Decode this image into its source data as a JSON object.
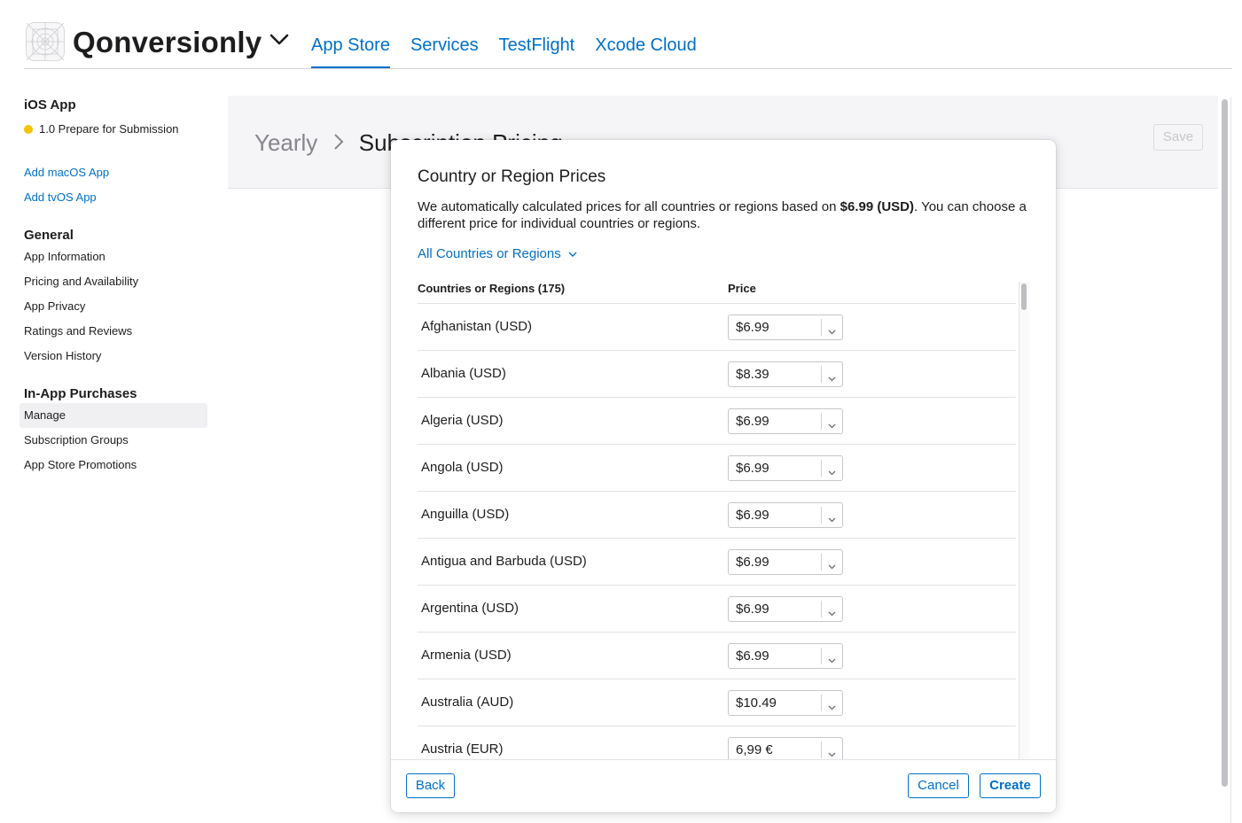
{
  "header": {
    "app_name": "Qonversionly",
    "tabs": [
      {
        "label": "App Store",
        "active": true
      },
      {
        "label": "Services"
      },
      {
        "label": "TestFlight"
      },
      {
        "label": "Xcode Cloud"
      }
    ]
  },
  "sidebar": {
    "ios_heading": "iOS App",
    "version_status": "1.0 Prepare for Submission",
    "status_color": "#f5c400",
    "add_links": [
      "Add macOS App",
      "Add tvOS App"
    ],
    "general_heading": "General",
    "general_items": [
      "App Information",
      "Pricing and Availability",
      "App Privacy",
      "Ratings and Reviews",
      "Version History"
    ],
    "iap_heading": "In-App Purchases",
    "iap_items": [
      "Manage",
      "Subscription Groups",
      "App Store Promotions"
    ],
    "selected_item": "Manage"
  },
  "page": {
    "breadcrumb_parent": "Yearly",
    "breadcrumb_current": "Subscription Pricing",
    "save_label": "Save"
  },
  "modal": {
    "title": "Country or Region Prices",
    "desc_before": "We automatically calculated prices for all countries or regions based on ",
    "desc_price": "$6.99 (USD)",
    "desc_after": ". You can choose a different price for individual countries or regions.",
    "filter_label": "All Countries or Regions",
    "col_country": "Countries or Regions (175)",
    "col_price": "Price",
    "rows": [
      {
        "country": "Afghanistan (USD)",
        "price": "$6.99"
      },
      {
        "country": "Albania (USD)",
        "price": "$8.39"
      },
      {
        "country": "Algeria (USD)",
        "price": "$6.99"
      },
      {
        "country": "Angola (USD)",
        "price": "$6.99"
      },
      {
        "country": "Anguilla (USD)",
        "price": "$6.99"
      },
      {
        "country": "Antigua and Barbuda (USD)",
        "price": "$6.99"
      },
      {
        "country": "Argentina (USD)",
        "price": "$6.99"
      },
      {
        "country": "Armenia (USD)",
        "price": "$6.99"
      },
      {
        "country": "Australia (AUD)",
        "price": "$10.49"
      },
      {
        "country": "Austria (EUR)",
        "price": "6,99 €"
      }
    ],
    "back_label": "Back",
    "cancel_label": "Cancel",
    "create_label": "Create"
  },
  "colors": {
    "accent": "#0070c9"
  }
}
